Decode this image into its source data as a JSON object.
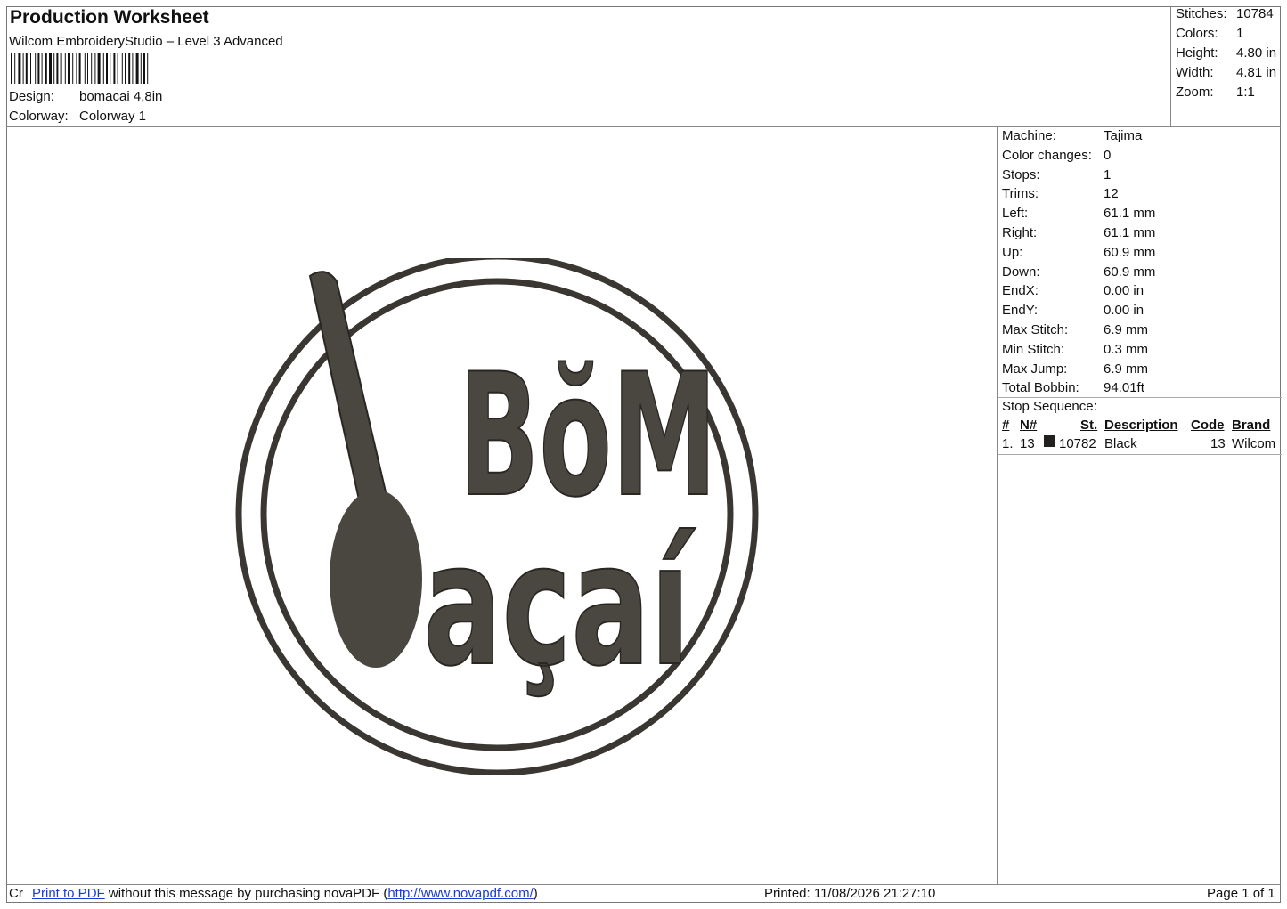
{
  "header": {
    "title": "Production Worksheet",
    "subtitle": "Wilcom EmbroideryStudio – Level 3 Advanced",
    "design_label": "Design:",
    "design_value": "bomacai 4,8in",
    "colorway_label": "Colorway:",
    "colorway_value": "Colorway 1"
  },
  "stats": {
    "stitches_label": "Stitches:",
    "stitches": "10784",
    "colors_label": "Colors:",
    "colors": "1",
    "height_label": "Height:",
    "height": "4.80 in",
    "width_label": "Width:",
    "width": "4.81 in",
    "zoom_label": "Zoom:",
    "zoom": "1:1"
  },
  "machine_info": [
    {
      "label": "Machine:",
      "value": "Tajima"
    },
    {
      "label": "Color changes:",
      "value": "0"
    },
    {
      "label": "Stops:",
      "value": "1"
    },
    {
      "label": "Trims:",
      "value": "12"
    },
    {
      "label": "Left:",
      "value": "61.1 mm"
    },
    {
      "label": "Right:",
      "value": "61.1 mm"
    },
    {
      "label": "Up:",
      "value": "60.9 mm"
    },
    {
      "label": "Down:",
      "value": "60.9 mm"
    },
    {
      "label": "EndX:",
      "value": "0.00 in"
    },
    {
      "label": "EndY:",
      "value": "0.00 in"
    },
    {
      "label": "Max Stitch:",
      "value": "6.9 mm"
    },
    {
      "label": "Min Stitch:",
      "value": "0.3 mm"
    },
    {
      "label": "Max Jump:",
      "value": "6.9 mm"
    },
    {
      "label": "Total Bobbin:",
      "value": "94.01ft"
    }
  ],
  "stop_sequence": {
    "title": "Stop Sequence:",
    "columns": {
      "num": "#",
      "needle": "N#",
      "stitches": "St.",
      "description": "Description",
      "code": "Code",
      "brand": "Brand"
    },
    "rows": [
      {
        "num": "1.",
        "needle": "13",
        "swatch_color": "#231f1c",
        "stitches": "10782",
        "description": "Black",
        "code": "13",
        "brand": "Wilcom"
      }
    ]
  },
  "design_text": {
    "line1": "BŏM",
    "line2": "açaí",
    "thread_color": "#4a4640"
  },
  "footer": {
    "prefix": "Cr",
    "link1": "Print to PDF",
    "middle": "without this message by purchasing novaPDF (",
    "link2": "http://www.novapdf.com/",
    "suffix": ")",
    "printed": "Printed: 11/08/2026 21:27:10",
    "page": "Page 1 of 1"
  }
}
